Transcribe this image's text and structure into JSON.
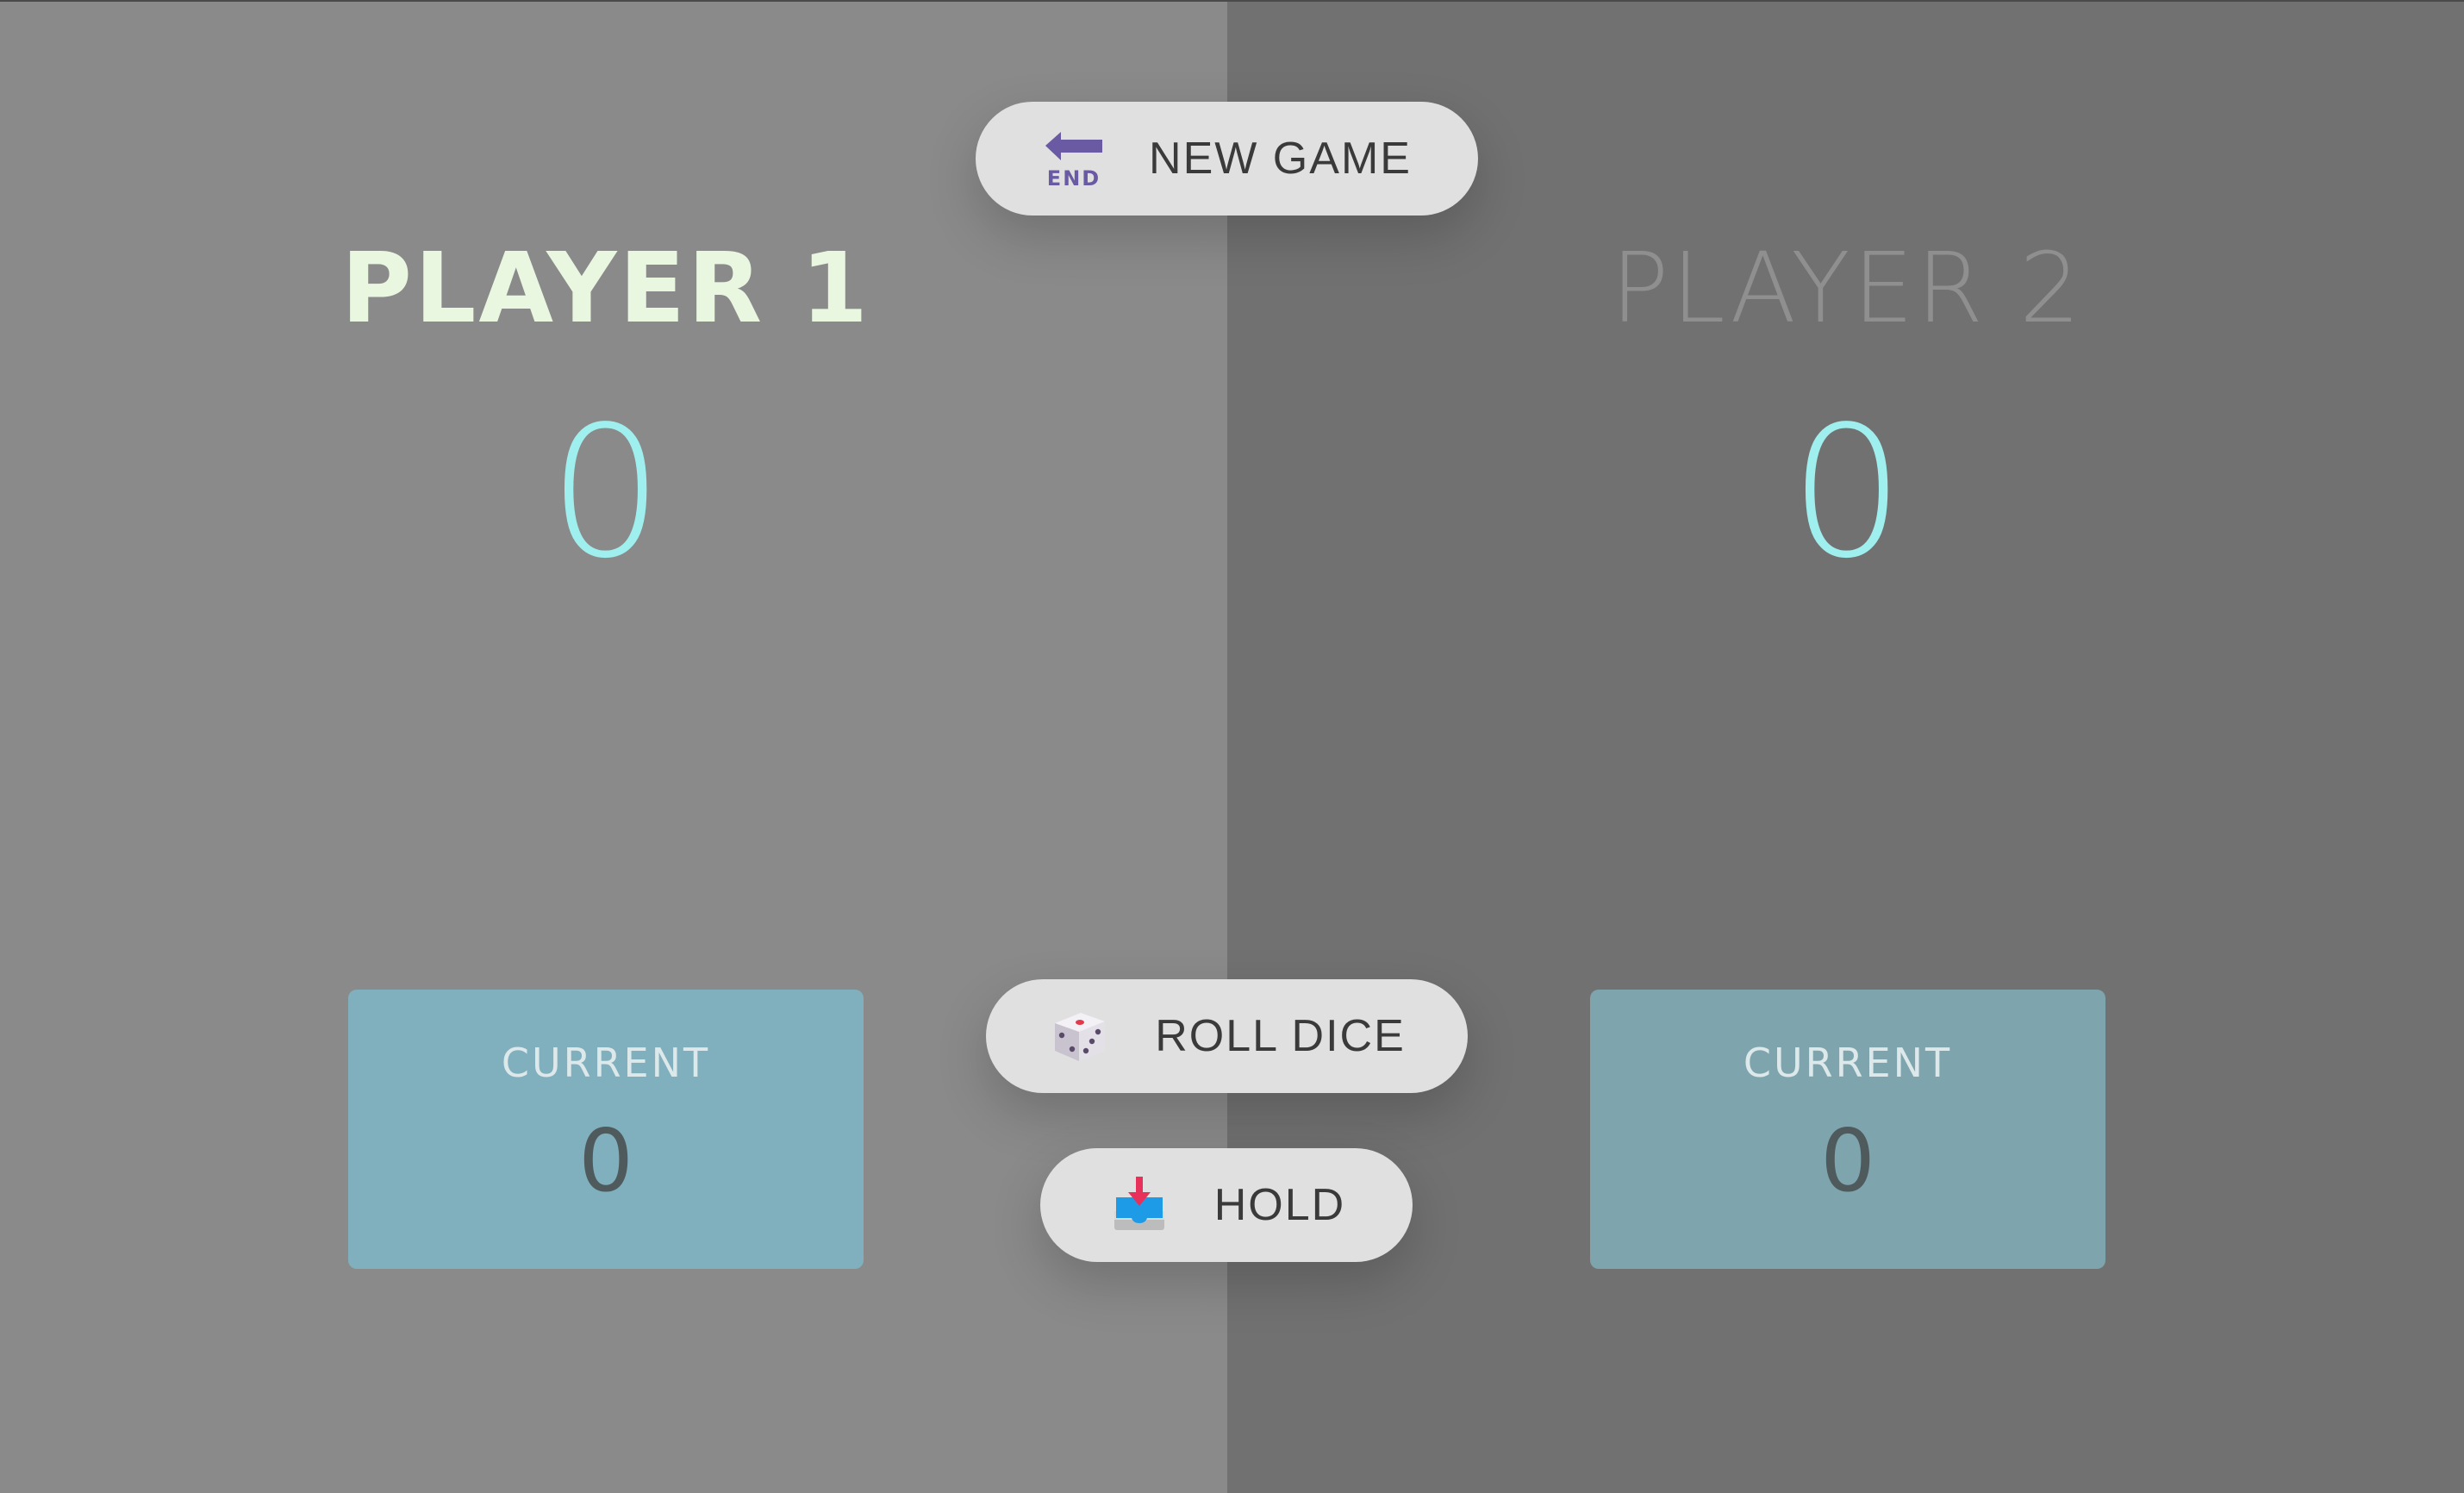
{
  "game": {
    "new_game_label": "NEW GAME",
    "roll_dice_label": "ROLL DICE",
    "hold_label": "HOLD"
  },
  "players": [
    {
      "name": "PLAYER 1",
      "score": "0",
      "current_label": "CURRENT",
      "current_value": "0",
      "active": true
    },
    {
      "name": "PLAYER 2",
      "score": "0",
      "current_label": "CURRENT",
      "current_value": "0",
      "active": false
    }
  ],
  "icons": {
    "new_game": "end-arrow-icon",
    "roll_dice": "dice-icon",
    "hold": "inbox-tray-icon"
  },
  "colors": {
    "active_panel": "#8a8a8a",
    "inactive_panel": "#717171",
    "score": "#9fefef",
    "active_name": "#e9f7e1",
    "inactive_name": "#8f8f8f",
    "button_bg": "#e0e0e0"
  }
}
